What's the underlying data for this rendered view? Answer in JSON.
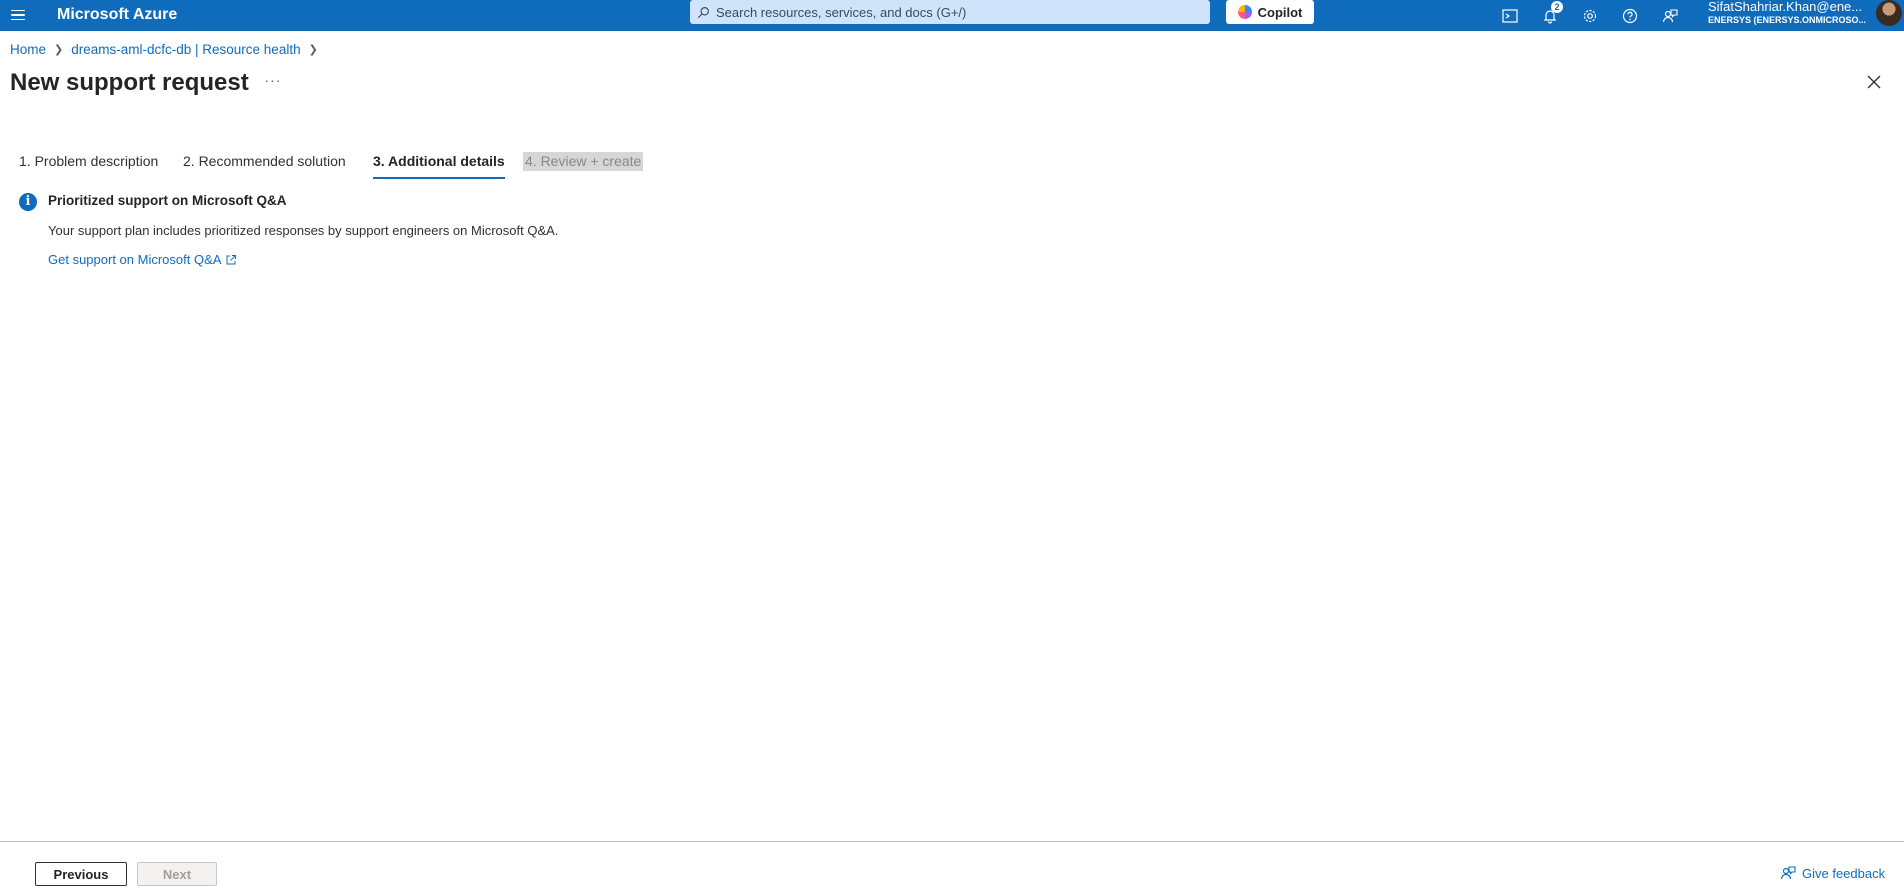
{
  "topbar": {
    "brand": "Microsoft Azure",
    "search_placeholder": "Search resources, services, and docs (G+/)",
    "copilot_label": "Copilot",
    "notification_count": "2",
    "account_name": "SifatShahriar.Khan@ene...",
    "account_tenant": "ENERSYS (ENERSYS.ONMICROSO..."
  },
  "breadcrumb": {
    "items": [
      "Home",
      "dreams-aml-dcfc-db | Resource health"
    ]
  },
  "page": {
    "title": "New support request",
    "more_label": "···"
  },
  "tabs": [
    {
      "label": "1. Problem description",
      "state": "normal"
    },
    {
      "label": "2. Recommended solution",
      "state": "normal"
    },
    {
      "label": "3. Additional details",
      "state": "active"
    },
    {
      "label": "4. Review + create",
      "state": "disabled"
    }
  ],
  "info": {
    "title": "Prioritized support on Microsoft Q&A",
    "body": "Your support plan includes prioritized responses by support engineers on Microsoft Q&A.",
    "link": "Get support on Microsoft Q&A"
  },
  "footer": {
    "previous_label": "Previous",
    "next_label": "Next",
    "feedback_label": "Give feedback"
  },
  "colors": {
    "brand_blue": "#0f6cbd",
    "search_bg": "#cfe4fa",
    "text": "#323130"
  }
}
